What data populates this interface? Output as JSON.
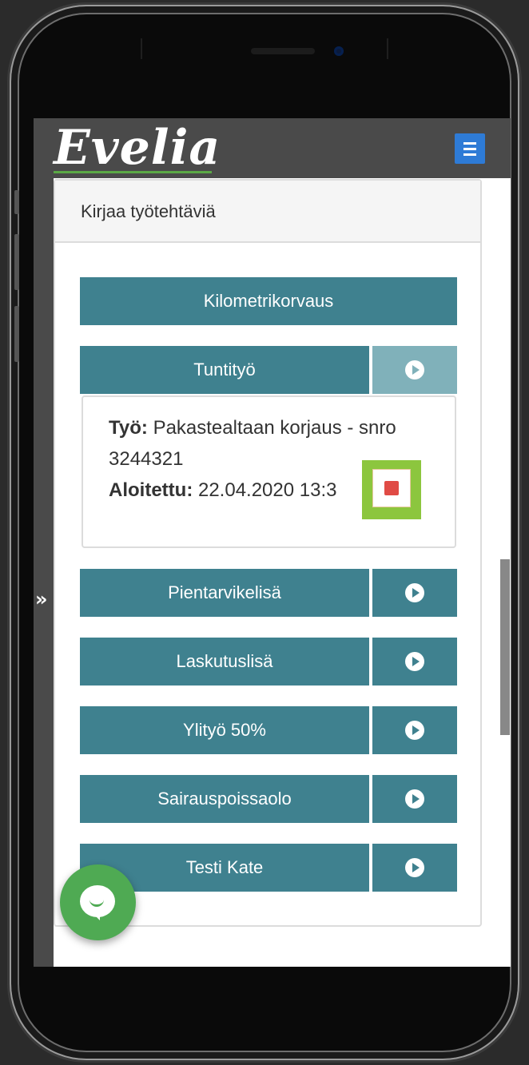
{
  "app": {
    "logo_text": "Evelia"
  },
  "panel": {
    "title": "Kirjaa työtehtäviä"
  },
  "tasks": [
    {
      "label": "Kilometrikorvaus",
      "has_play": false
    },
    {
      "label": "Tuntityö",
      "has_play": true,
      "active": true
    },
    {
      "label": "Pientarvikelisä",
      "has_play": true
    },
    {
      "label": "Laskutuslisä",
      "has_play": true
    },
    {
      "label": "Ylityö 50%",
      "has_play": true
    },
    {
      "label": "Sairauspoissaolo",
      "has_play": true
    },
    {
      "label": "Testi Kate",
      "has_play": true
    }
  ],
  "running": {
    "work_label": "Työ:",
    "work_value": "Pakastealtaan korjaus - snro",
    "work_value_2": "3244321",
    "started_label": "Aloitettu:",
    "started_value": "22.04.2020 13:3"
  },
  "colors": {
    "button": "#3f818f",
    "button_faded": "#80b1ba",
    "header": "#4a4a4a",
    "highlight": "#8cc63e",
    "stop": "#e04b45",
    "chat": "#4faa53",
    "menu": "#2e7bd6"
  },
  "icons": {
    "menu": "hamburger-icon",
    "expand": "double-chevron-right-icon",
    "play": "play-icon",
    "stop": "stop-icon",
    "chat": "chat-icon"
  }
}
